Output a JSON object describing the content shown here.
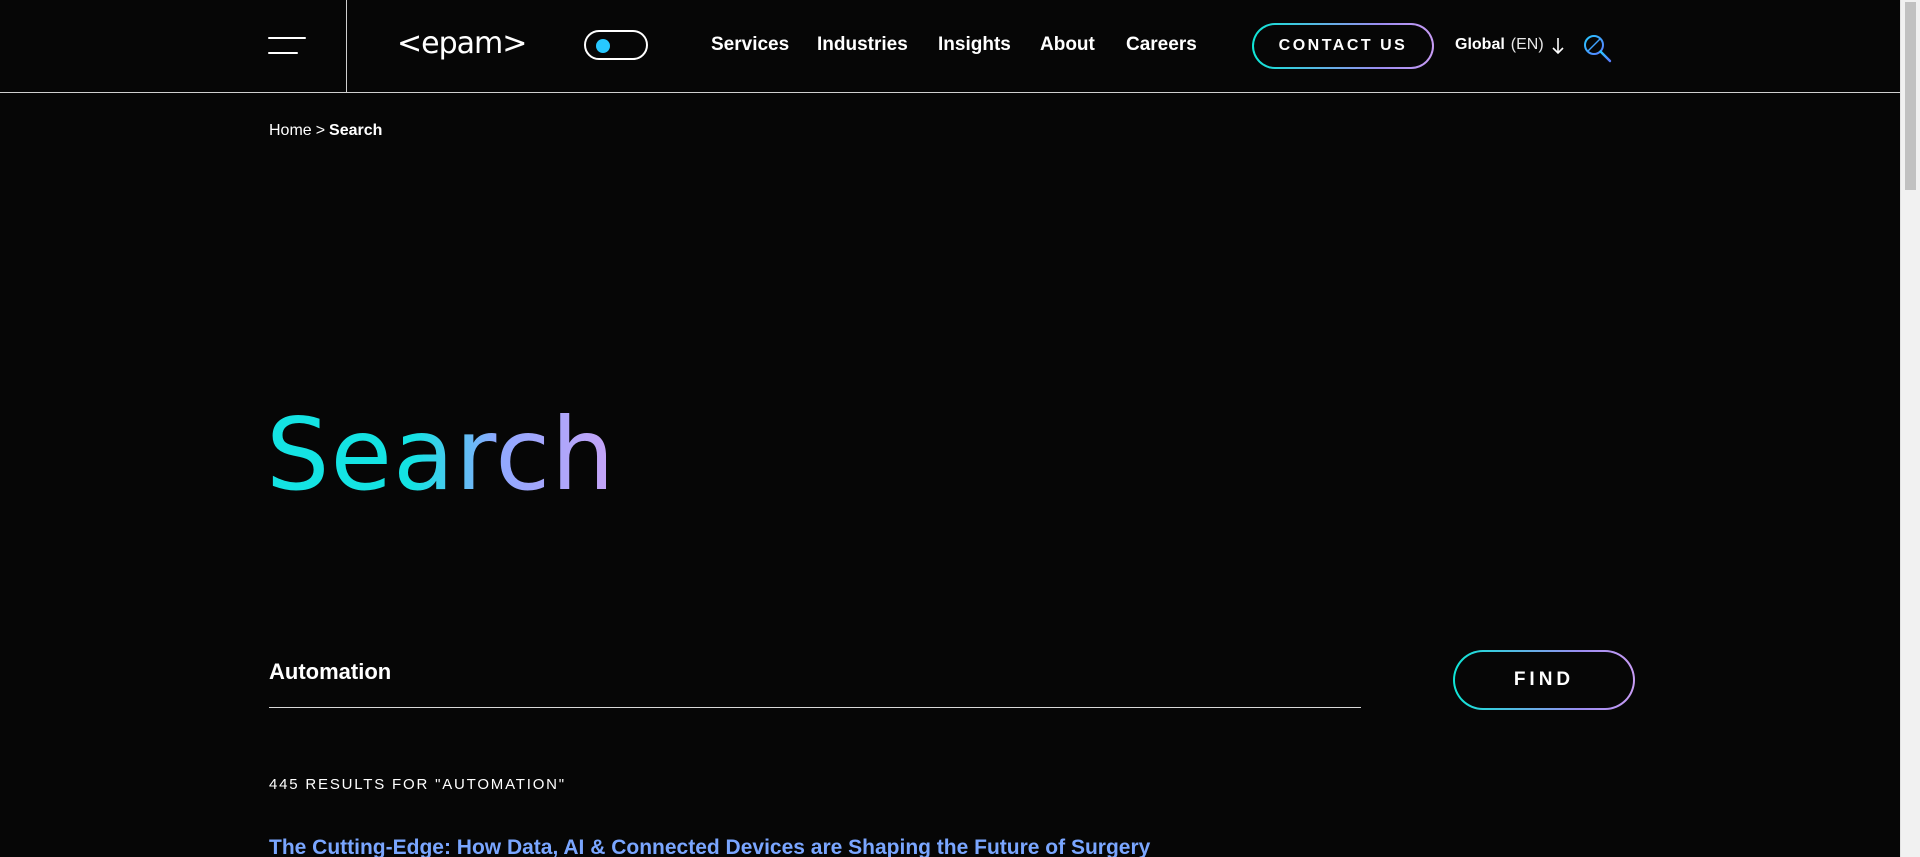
{
  "header": {
    "logo_text": "<epam>",
    "nav": [
      {
        "label": "Services"
      },
      {
        "label": "Industries"
      },
      {
        "label": "Insights"
      },
      {
        "label": "About"
      },
      {
        "label": "Careers"
      }
    ],
    "contact_label": "CONTACT US",
    "language": {
      "region": "Global",
      "code": "(EN)"
    },
    "icons": {
      "menu": "hamburger-icon",
      "theme": "theme-toggle",
      "language": "arrow-down-icon",
      "search": "search-icon"
    },
    "accent_color": "#27c8ff"
  },
  "breadcrumb": {
    "home": "Home",
    "separator": ">",
    "current": "Search"
  },
  "page": {
    "title": "Search",
    "title_gradient": [
      "#14e3e3",
      "#8fa8ff",
      "#c7a4f7"
    ]
  },
  "search": {
    "value": "Automation",
    "placeholder": "",
    "find_label": "FIND"
  },
  "results": {
    "count_text": "445 RESULTS FOR \"AUTOMATION\"",
    "items": [
      {
        "title": "The Cutting-Edge: How Data, AI & Connected Devices are Shaping the Future of Surgery"
      }
    ],
    "link_color": "#7aa6ff"
  }
}
